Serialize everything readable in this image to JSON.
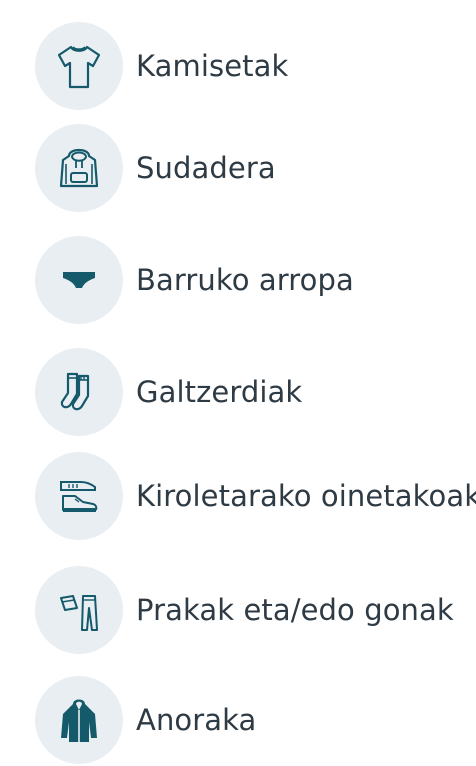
{
  "categories": [
    {
      "label": "Kamisetak",
      "icon": "tshirt-icon"
    },
    {
      "label": "Sudadera",
      "icon": "hoodie-icon"
    },
    {
      "label": "Barruko arropa",
      "icon": "underwear-icon"
    },
    {
      "label": "Galtzerdiak",
      "icon": "socks-icon"
    },
    {
      "label": "Kiroletarako oinetakoak",
      "icon": "sneakers-icon"
    },
    {
      "label": "Prakak eta/edo gonak",
      "icon": "pants-skirt-icon"
    },
    {
      "label": "Anoraka",
      "icon": "anorak-icon"
    }
  ],
  "colors": {
    "icon": "#155a6a",
    "circle": "#e8eef2",
    "text": "#2e3a44"
  }
}
